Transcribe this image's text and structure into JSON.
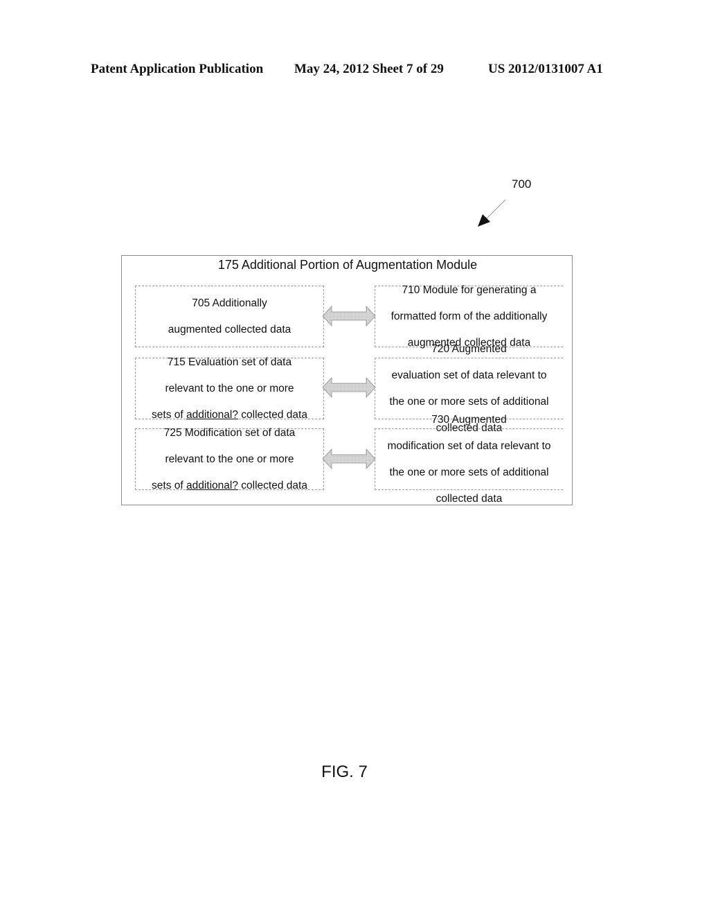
{
  "header": {
    "publication": "Patent Application Publication",
    "date_sheet": "May 24, 2012  Sheet 7 of 29",
    "number": "US 2012/0131007 A1"
  },
  "figure": {
    "reference": "700",
    "label": "FIG. 7"
  },
  "module": {
    "title": "175 Additional Portion of  Augmentation Module",
    "rows": [
      {
        "left": {
          "line1": "705  Additionally",
          "line2": "augmented collected data"
        },
        "right": {
          "line1": "710  Module for generating a",
          "line2": "formatted form of the additionally",
          "line3": "augmented collected data"
        }
      },
      {
        "left": {
          "line1": "715   Evaluation set of data",
          "line2": "relevant to the one or more",
          "line3_pre": "sets of ",
          "line3_u": "additional?",
          "line3_post": " collected data"
        },
        "right": {
          "line1": "720   Augmented",
          "line2": "evaluation set of data relevant to",
          "line3": "the one or more sets of additional",
          "line4": "collected data"
        }
      },
      {
        "left": {
          "line1": "725  Modification set of data",
          "line2": "relevant to the one or more",
          "line3_pre": "sets of ",
          "line3_u": "additional?",
          "line3_post": " collected data"
        },
        "right": {
          "line1": "730  Augmented",
          "line2": "modification set of data relevant to",
          "line3": "the one or more sets of additional",
          "line4": "collected data"
        }
      }
    ]
  },
  "colors": {
    "box_border": "#9a9a9a",
    "arrow_fill": "#c8c8c8",
    "arrow_stroke": "#8a8a8a"
  }
}
